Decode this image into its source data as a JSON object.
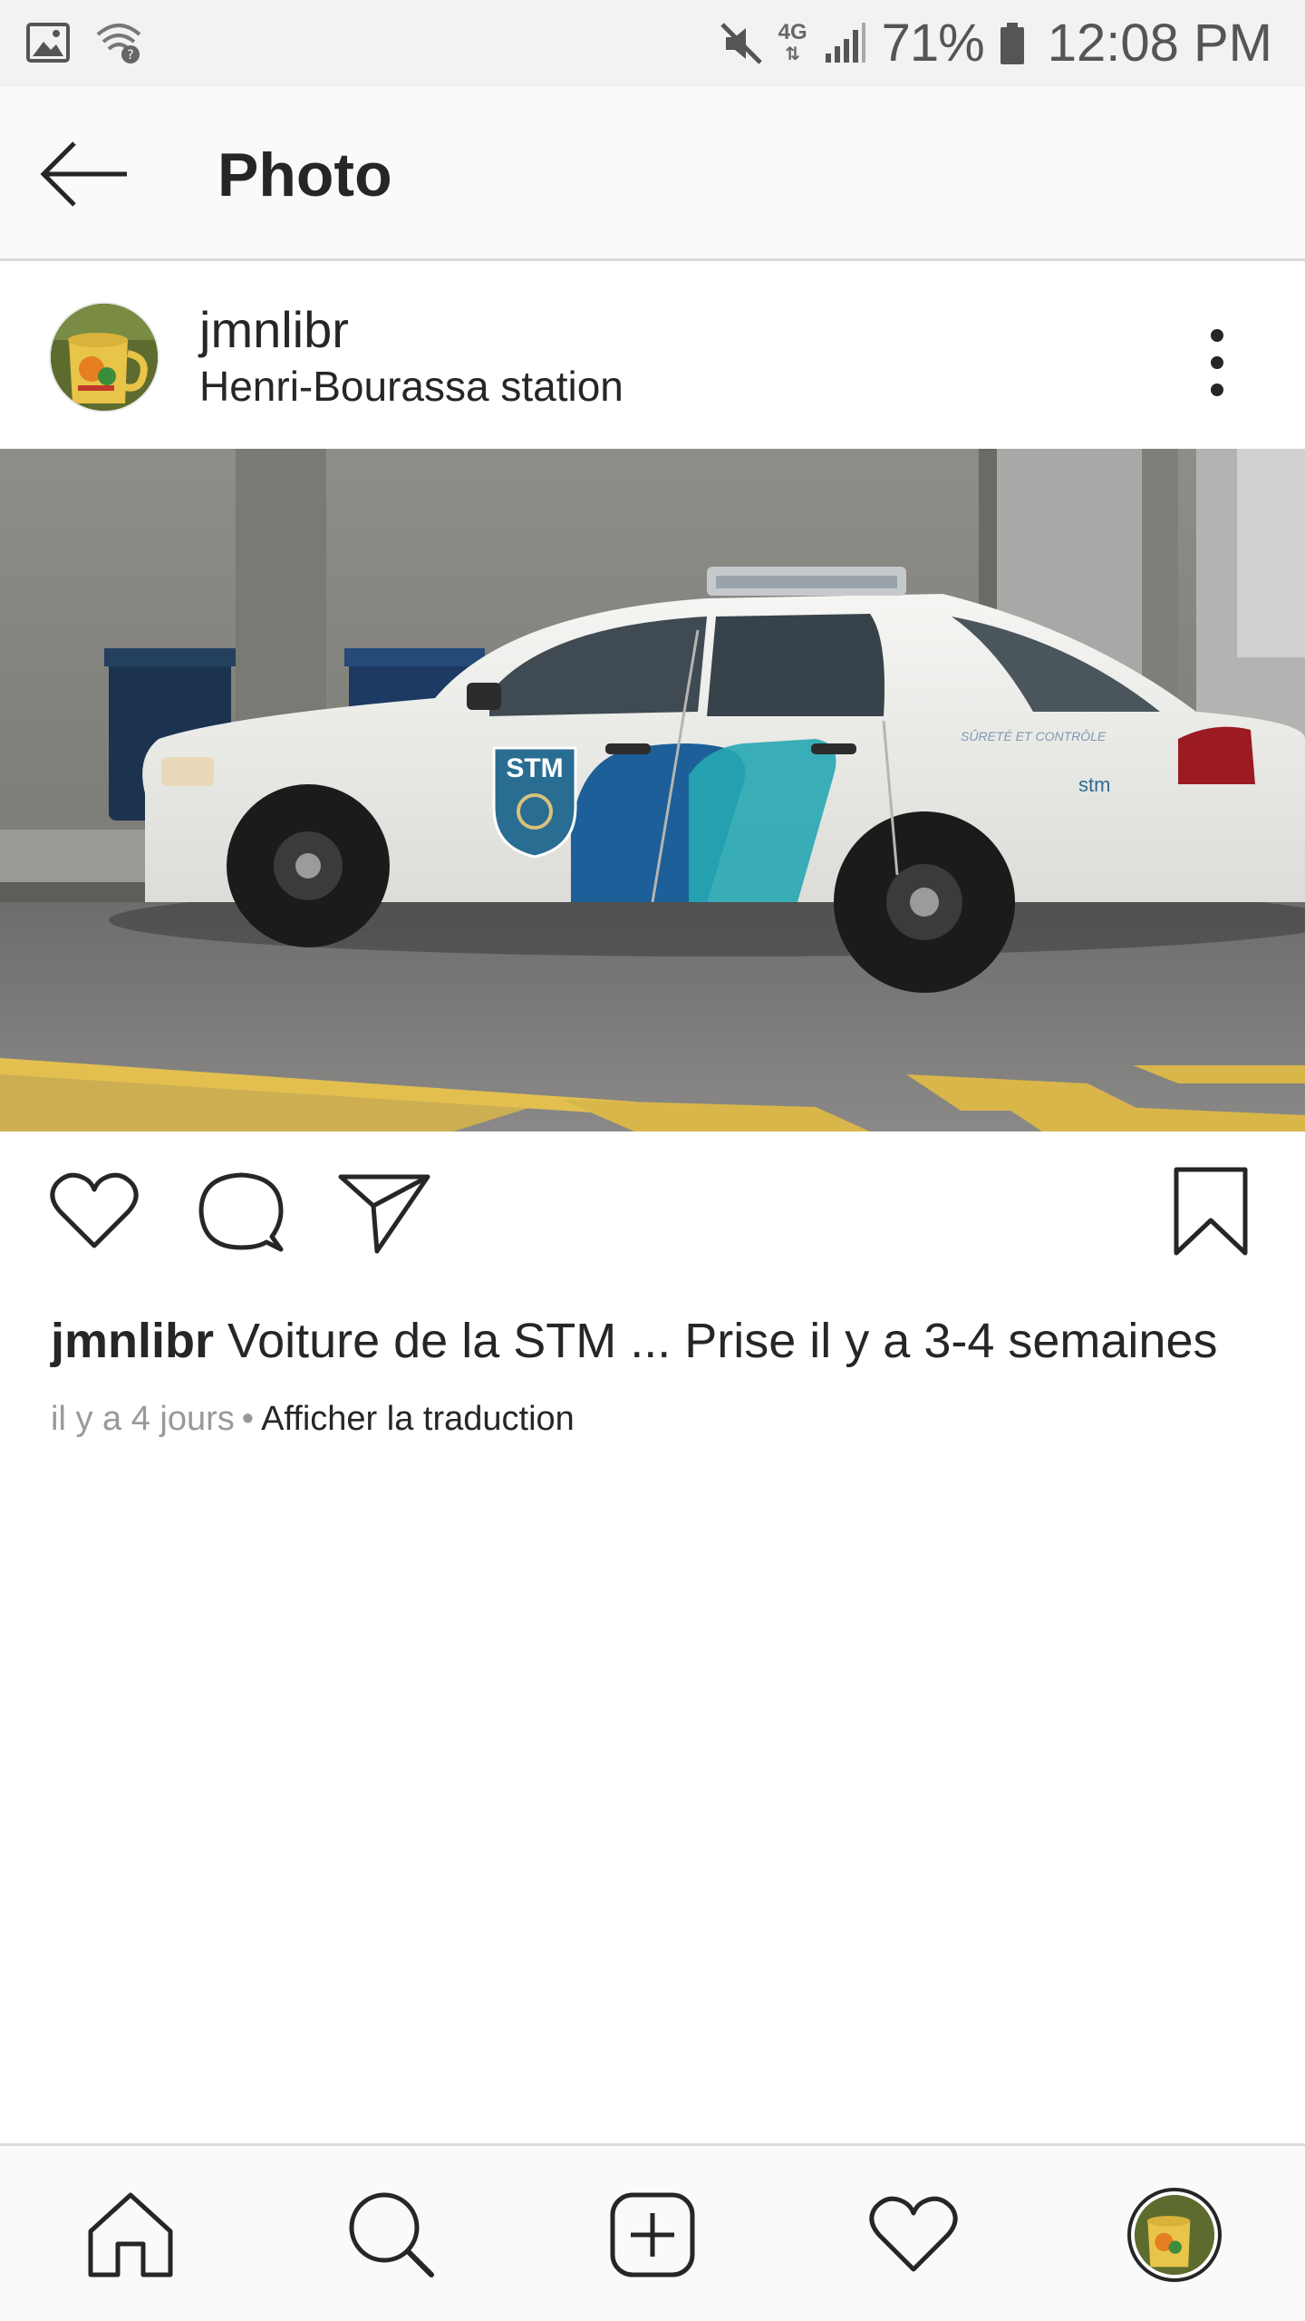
{
  "status_bar": {
    "network": "4G",
    "battery": "71%",
    "time": "12:08 PM",
    "icons": [
      "image-icon",
      "wifi-question-icon",
      "mute-icon",
      "signal-icon",
      "battery-icon"
    ]
  },
  "header": {
    "title": "Photo",
    "back_icon": "arrow-left-icon"
  },
  "post": {
    "username": "jmnlibr",
    "location": "Henri-Bourassa station",
    "more_icon": "more-vertical-icon",
    "photo_text": {
      "logo": "STM",
      "door_text": "SÛRETÉ ET CONTRÔLE",
      "brand": "stm"
    },
    "actions": [
      "heart-icon",
      "comment-icon",
      "share-icon",
      "bookmark-icon"
    ],
    "caption_user": "jmnlibr",
    "caption_text": "Voiture de la STM ... Prise il y a 3-4 semaines",
    "time_ago": "il y a 4 jours",
    "separator": "•",
    "translate_label": "Afficher la traduction"
  },
  "bottom_nav": {
    "items": [
      "home-icon",
      "search-icon",
      "add-icon",
      "activity-heart-icon",
      "profile-avatar"
    ]
  },
  "colors": {
    "text": "#262626",
    "muted": "#999999",
    "border": "#dbdbdb",
    "bar_bg": "#fafafa"
  }
}
